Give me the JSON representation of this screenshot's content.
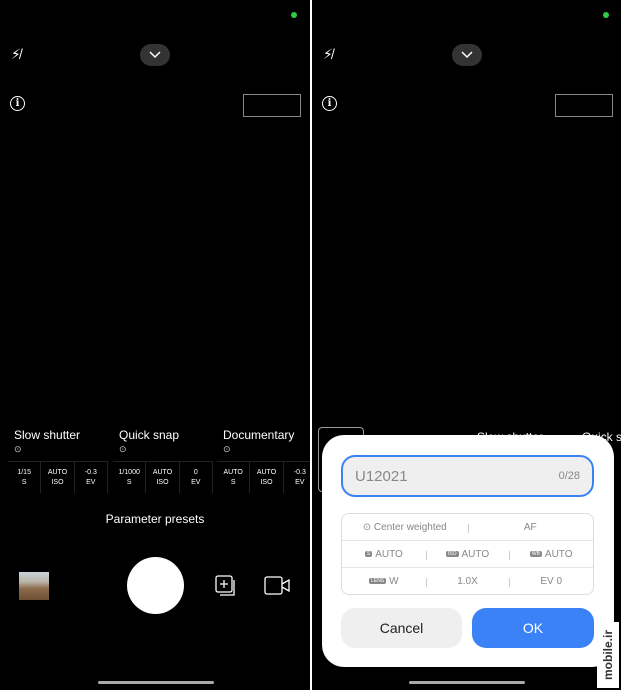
{
  "left": {
    "presets": [
      {
        "name": "Slow shutter",
        "values": [
          [
            "1/15",
            "S"
          ],
          [
            "AUTO",
            "ISO"
          ],
          [
            "-0.3",
            "EV"
          ]
        ]
      },
      {
        "name": "Quick snap",
        "values": [
          [
            "1/1000",
            "S"
          ],
          [
            "AUTO",
            "ISO"
          ],
          [
            "0",
            "EV"
          ]
        ]
      },
      {
        "name": "Documentary",
        "values": [
          [
            "AUTO",
            "S"
          ],
          [
            "AUTO",
            "ISO"
          ],
          [
            "-0.3",
            "EV"
          ]
        ]
      }
    ],
    "presets_label": "Parameter presets"
  },
  "right": {
    "behind_presets": [
      "Slow shutter",
      "Quick sn"
    ],
    "dialog": {
      "name_value": "U12021",
      "char_count": "0/28",
      "metering": "Center weighted",
      "focus": "AF",
      "shutter": "AUTO",
      "shutter_tag": "S",
      "iso": "AUTO",
      "iso_tag": "ISO",
      "wb": "AUTO",
      "wb_tag": "WB",
      "lens": "W",
      "lens_tag": "LENS",
      "zoom": "1.0X",
      "ev": "EV 0",
      "cancel": "Cancel",
      "ok": "OK"
    }
  },
  "watermark": "mobile.ir",
  "colors": {
    "accent": "#3b82f6",
    "status_dot": "#2ecc40"
  }
}
